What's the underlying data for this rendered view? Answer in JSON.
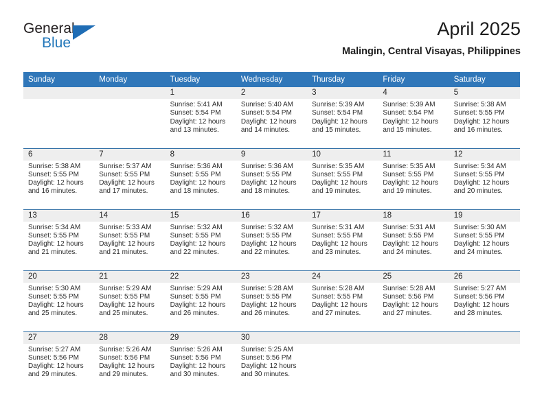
{
  "logo": {
    "primary_text": "General",
    "secondary_text": "Blue",
    "triangle_icon": "triangle-icon",
    "primary_color": "#231f20",
    "secondary_color": "#2176b9",
    "triangle_color": "#1f6db5"
  },
  "header": {
    "title": "April 2025",
    "subtitle": "Malingin, Central Visayas, Philippines"
  },
  "theme": {
    "header_blue": "#3077b9",
    "row_divider": "#2e6da4",
    "daynum_band": "#eeeeee"
  },
  "columns": [
    "Sunday",
    "Monday",
    "Tuesday",
    "Wednesday",
    "Thursday",
    "Friday",
    "Saturday"
  ],
  "weeks": [
    [
      {
        "day": "",
        "empty": true,
        "sunrise": "",
        "sunset": "",
        "daylight": ""
      },
      {
        "day": "",
        "empty": true,
        "sunrise": "",
        "sunset": "",
        "daylight": ""
      },
      {
        "day": "1",
        "empty": false,
        "sunrise": "Sunrise: 5:41 AM",
        "sunset": "Sunset: 5:54 PM",
        "daylight": "Daylight: 12 hours and 13 minutes."
      },
      {
        "day": "2",
        "empty": false,
        "sunrise": "Sunrise: 5:40 AM",
        "sunset": "Sunset: 5:54 PM",
        "daylight": "Daylight: 12 hours and 14 minutes."
      },
      {
        "day": "3",
        "empty": false,
        "sunrise": "Sunrise: 5:39 AM",
        "sunset": "Sunset: 5:54 PM",
        "daylight": "Daylight: 12 hours and 15 minutes."
      },
      {
        "day": "4",
        "empty": false,
        "sunrise": "Sunrise: 5:39 AM",
        "sunset": "Sunset: 5:54 PM",
        "daylight": "Daylight: 12 hours and 15 minutes."
      },
      {
        "day": "5",
        "empty": false,
        "sunrise": "Sunrise: 5:38 AM",
        "sunset": "Sunset: 5:55 PM",
        "daylight": "Daylight: 12 hours and 16 minutes."
      }
    ],
    [
      {
        "day": "6",
        "empty": false,
        "sunrise": "Sunrise: 5:38 AM",
        "sunset": "Sunset: 5:55 PM",
        "daylight": "Daylight: 12 hours and 16 minutes."
      },
      {
        "day": "7",
        "empty": false,
        "sunrise": "Sunrise: 5:37 AM",
        "sunset": "Sunset: 5:55 PM",
        "daylight": "Daylight: 12 hours and 17 minutes."
      },
      {
        "day": "8",
        "empty": false,
        "sunrise": "Sunrise: 5:36 AM",
        "sunset": "Sunset: 5:55 PM",
        "daylight": "Daylight: 12 hours and 18 minutes."
      },
      {
        "day": "9",
        "empty": false,
        "sunrise": "Sunrise: 5:36 AM",
        "sunset": "Sunset: 5:55 PM",
        "daylight": "Daylight: 12 hours and 18 minutes."
      },
      {
        "day": "10",
        "empty": false,
        "sunrise": "Sunrise: 5:35 AM",
        "sunset": "Sunset: 5:55 PM",
        "daylight": "Daylight: 12 hours and 19 minutes."
      },
      {
        "day": "11",
        "empty": false,
        "sunrise": "Sunrise: 5:35 AM",
        "sunset": "Sunset: 5:55 PM",
        "daylight": "Daylight: 12 hours and 19 minutes."
      },
      {
        "day": "12",
        "empty": false,
        "sunrise": "Sunrise: 5:34 AM",
        "sunset": "Sunset: 5:55 PM",
        "daylight": "Daylight: 12 hours and 20 minutes."
      }
    ],
    [
      {
        "day": "13",
        "empty": false,
        "sunrise": "Sunrise: 5:34 AM",
        "sunset": "Sunset: 5:55 PM",
        "daylight": "Daylight: 12 hours and 21 minutes."
      },
      {
        "day": "14",
        "empty": false,
        "sunrise": "Sunrise: 5:33 AM",
        "sunset": "Sunset: 5:55 PM",
        "daylight": "Daylight: 12 hours and 21 minutes."
      },
      {
        "day": "15",
        "empty": false,
        "sunrise": "Sunrise: 5:32 AM",
        "sunset": "Sunset: 5:55 PM",
        "daylight": "Daylight: 12 hours and 22 minutes."
      },
      {
        "day": "16",
        "empty": false,
        "sunrise": "Sunrise: 5:32 AM",
        "sunset": "Sunset: 5:55 PM",
        "daylight": "Daylight: 12 hours and 22 minutes."
      },
      {
        "day": "17",
        "empty": false,
        "sunrise": "Sunrise: 5:31 AM",
        "sunset": "Sunset: 5:55 PM",
        "daylight": "Daylight: 12 hours and 23 minutes."
      },
      {
        "day": "18",
        "empty": false,
        "sunrise": "Sunrise: 5:31 AM",
        "sunset": "Sunset: 5:55 PM",
        "daylight": "Daylight: 12 hours and 24 minutes."
      },
      {
        "day": "19",
        "empty": false,
        "sunrise": "Sunrise: 5:30 AM",
        "sunset": "Sunset: 5:55 PM",
        "daylight": "Daylight: 12 hours and 24 minutes."
      }
    ],
    [
      {
        "day": "20",
        "empty": false,
        "sunrise": "Sunrise: 5:30 AM",
        "sunset": "Sunset: 5:55 PM",
        "daylight": "Daylight: 12 hours and 25 minutes."
      },
      {
        "day": "21",
        "empty": false,
        "sunrise": "Sunrise: 5:29 AM",
        "sunset": "Sunset: 5:55 PM",
        "daylight": "Daylight: 12 hours and 25 minutes."
      },
      {
        "day": "22",
        "empty": false,
        "sunrise": "Sunrise: 5:29 AM",
        "sunset": "Sunset: 5:55 PM",
        "daylight": "Daylight: 12 hours and 26 minutes."
      },
      {
        "day": "23",
        "empty": false,
        "sunrise": "Sunrise: 5:28 AM",
        "sunset": "Sunset: 5:55 PM",
        "daylight": "Daylight: 12 hours and 26 minutes."
      },
      {
        "day": "24",
        "empty": false,
        "sunrise": "Sunrise: 5:28 AM",
        "sunset": "Sunset: 5:55 PM",
        "daylight": "Daylight: 12 hours and 27 minutes."
      },
      {
        "day": "25",
        "empty": false,
        "sunrise": "Sunrise: 5:28 AM",
        "sunset": "Sunset: 5:56 PM",
        "daylight": "Daylight: 12 hours and 27 minutes."
      },
      {
        "day": "26",
        "empty": false,
        "sunrise": "Sunrise: 5:27 AM",
        "sunset": "Sunset: 5:56 PM",
        "daylight": "Daylight: 12 hours and 28 minutes."
      }
    ],
    [
      {
        "day": "27",
        "empty": false,
        "sunrise": "Sunrise: 5:27 AM",
        "sunset": "Sunset: 5:56 PM",
        "daylight": "Daylight: 12 hours and 29 minutes."
      },
      {
        "day": "28",
        "empty": false,
        "sunrise": "Sunrise: 5:26 AM",
        "sunset": "Sunset: 5:56 PM",
        "daylight": "Daylight: 12 hours and 29 minutes."
      },
      {
        "day": "29",
        "empty": false,
        "sunrise": "Sunrise: 5:26 AM",
        "sunset": "Sunset: 5:56 PM",
        "daylight": "Daylight: 12 hours and 30 minutes."
      },
      {
        "day": "30",
        "empty": false,
        "sunrise": "Sunrise: 5:25 AM",
        "sunset": "Sunset: 5:56 PM",
        "daylight": "Daylight: 12 hours and 30 minutes."
      },
      {
        "day": "",
        "empty": true,
        "sunrise": "",
        "sunset": "",
        "daylight": ""
      },
      {
        "day": "",
        "empty": true,
        "sunrise": "",
        "sunset": "",
        "daylight": ""
      },
      {
        "day": "",
        "empty": true,
        "sunrise": "",
        "sunset": "",
        "daylight": ""
      }
    ]
  ]
}
